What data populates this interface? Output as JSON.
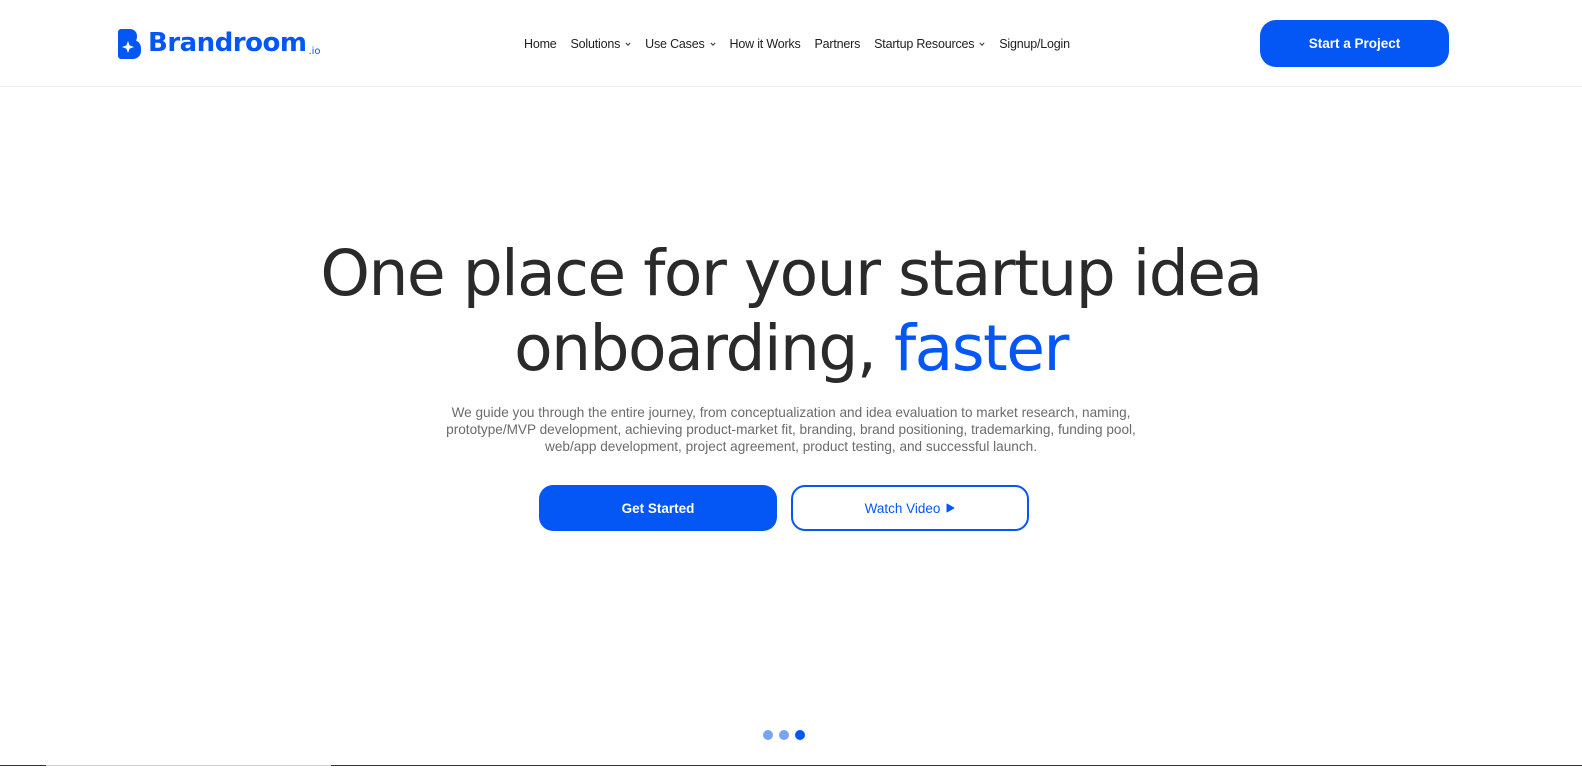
{
  "colors": {
    "accent": "#0457f5",
    "dot_inactive": "#7aa5f5",
    "dot_active": "#0457f5"
  },
  "header": {
    "logo": {
      "text": "Brandroom",
      "tld": ".io",
      "icon": "brandroom-logo-icon"
    },
    "nav": [
      {
        "label": "Home",
        "has_dropdown": false
      },
      {
        "label": "Solutions",
        "has_dropdown": true
      },
      {
        "label": "Use Cases",
        "has_dropdown": true
      },
      {
        "label": "How it Works",
        "has_dropdown": false
      },
      {
        "label": "Partners",
        "has_dropdown": false
      },
      {
        "label": "Startup Resources",
        "has_dropdown": true
      },
      {
        "label": "Signup/Login",
        "has_dropdown": false
      }
    ],
    "cta_label": "Start a Project"
  },
  "hero": {
    "title_line1": "One place for your startup idea",
    "title_line2_plain": "onboarding,",
    "title_line2_accent": "faster",
    "subtitle_line1": "We guide you through the entire journey, from conceptualization and idea evaluation to market research, naming,",
    "subtitle_line2": "prototype/MVP development, achieving product-market fit, branding, brand positioning, trademarking, funding pool,",
    "subtitle_line3": "web/app development, project agreement, product testing, and successful launch.",
    "primary_button": "Get Started",
    "secondary_button": "Watch Video",
    "secondary_button_icon": "play-icon"
  },
  "slider": {
    "count": 3,
    "active_index": 2
  }
}
